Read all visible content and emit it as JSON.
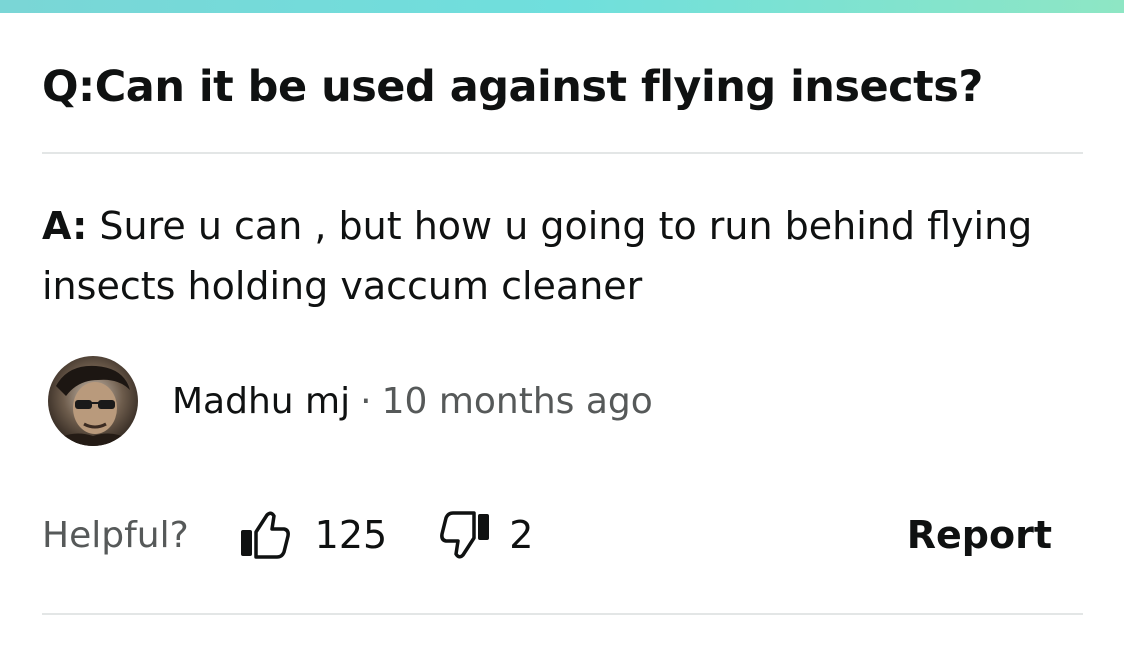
{
  "question": {
    "prefix": "Q:",
    "text": "Can it be used against flying insects?"
  },
  "answer": {
    "prefix": "A:",
    "text": "Sure u can , but how u going to run behind flying insects holding vaccum cleaner"
  },
  "author": {
    "name": "Madhu mj",
    "separator": "·",
    "time": "10 months ago",
    "avatar_icon": "user-avatar-photo"
  },
  "helpful": {
    "label": "Helpful?",
    "upvote_icon": "thumbs-up-icon",
    "upvote_count": "125",
    "downvote_icon": "thumbs-down-icon",
    "downvote_count": "2",
    "report_label": "Report"
  },
  "colors": {
    "accent_bar": "#6fdfdd",
    "text": "#0f1111",
    "muted": "#565959",
    "divider": "#e3e6e6"
  }
}
